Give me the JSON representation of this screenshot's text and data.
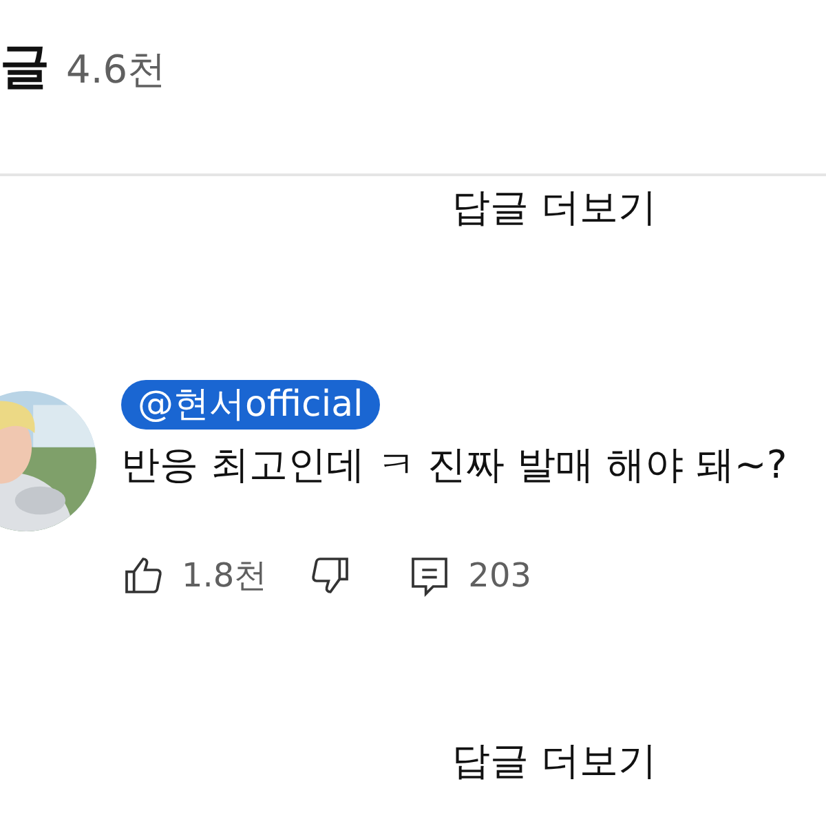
{
  "header": {
    "title": "글",
    "count": "4.6천"
  },
  "threads": [
    {
      "more_replies": "답글 더보기"
    },
    {
      "comment": {
        "author": "@현서official",
        "author_highlighted": true,
        "text": "반응 최고인데 ㅋ 진짜 발매 해야 돼~?",
        "likes": "1.8천",
        "replies": "203"
      },
      "more_replies": "답글 더보기"
    }
  ]
}
